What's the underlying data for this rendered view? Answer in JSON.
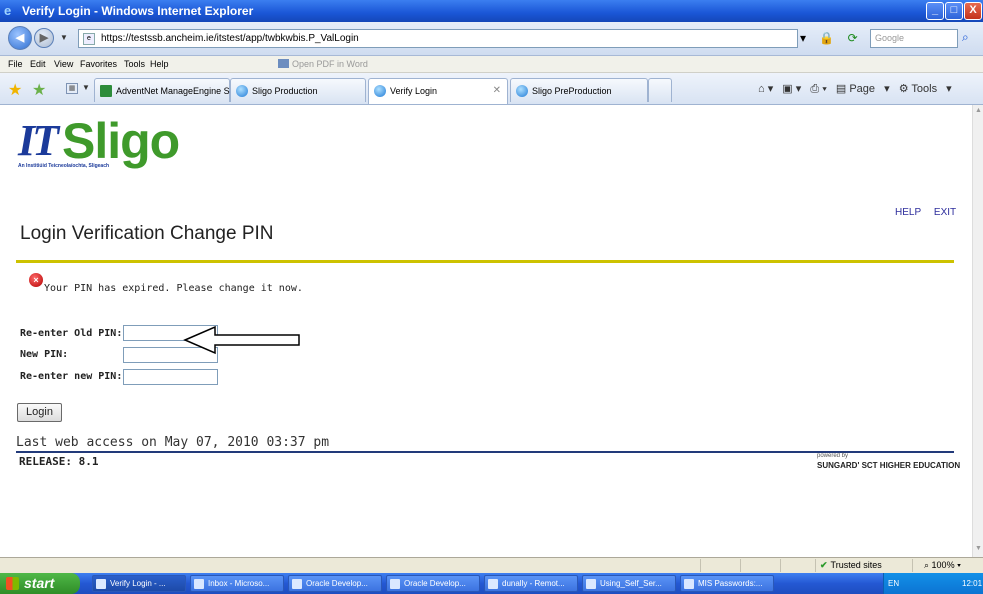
{
  "window": {
    "title": "Verify Login - Windows Internet Explorer",
    "min_label": "_",
    "max_label": "□",
    "close_label": "X"
  },
  "addressbar": {
    "url": "https://testssb.ancheim.ie/itstest/app/twbkwbis.P_ValLogin",
    "search_placeholder": "Google"
  },
  "menubar": {
    "items": [
      "File",
      "Edit",
      "View",
      "Favorites",
      "Tools",
      "Help"
    ],
    "pdf_label": "Open PDF in Word"
  },
  "tabs": [
    {
      "label": "AdventNet ManageEngine Se..."
    },
    {
      "label": "Sligo Production"
    },
    {
      "label": "Verify Login"
    },
    {
      "label": "Sligo PreProduction"
    }
  ],
  "commandbar": {
    "page_label": "Page",
    "tools_label": "Tools"
  },
  "page": {
    "logo_it": "IT",
    "logo_sligo": "Sligo",
    "logo_sub": "An Institiúid Teicneolaíochta, Sligeach",
    "help_link": "HELP",
    "exit_link": "EXIT",
    "heading": "Login Verification Change PIN",
    "error_message": "Your PIN has expired. Please change it now.",
    "fields": [
      {
        "label": "Re-enter Old PIN:",
        "value": ""
      },
      {
        "label": "New PIN:",
        "value": ""
      },
      {
        "label": "Re-enter new PIN:",
        "value": ""
      }
    ],
    "login_button": "Login",
    "last_access": "Last web access on May 07, 2010 03:37 pm",
    "release": "RELEASE: 8.1",
    "powered_by": "powered by",
    "vendor": "SUNGARD' SCT HIGHER EDUCATION"
  },
  "statusbar": {
    "zone": "Trusted sites",
    "zoom": "100%"
  },
  "taskbar": {
    "start_label": "start",
    "buttons": [
      {
        "label": "Verify Login - ..."
      },
      {
        "label": "Inbox - Microso..."
      },
      {
        "label": "Oracle Develop..."
      },
      {
        "label": "Oracle Develop..."
      },
      {
        "label": "dunally - Remot..."
      },
      {
        "label": "Using_Self_Ser..."
      },
      {
        "label": "MIS Passwords:..."
      }
    ],
    "language": "EN",
    "clock": "12:01"
  },
  "colors": {
    "heading_rule": "#cdc200",
    "footer_rule": "#223a7a",
    "link": "#2d2d9c",
    "logo_blue": "#1b3a9a",
    "logo_green": "#3f9a2b"
  }
}
